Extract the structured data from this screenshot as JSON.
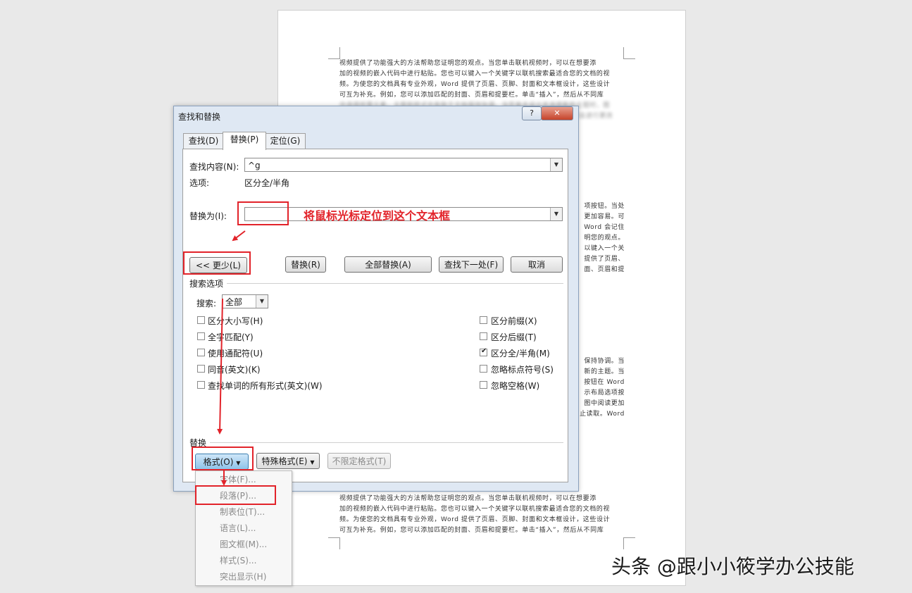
{
  "document": {
    "top_lines": [
      "视频提供了功能强大的方法帮助您证明您的观点。当您单击联机视频时，可以在想要添",
      "加的视频的嵌入代码中进行粘贴。您也可以键入一个关键字以联机搜索最适合您的文档的视",
      "频。为使您的文档具有专业外观，Word 提供了页眉、页脚、封面和文本框设计，这些设计",
      "可互为补充。例如，您可以添加匹配的封面、页眉和提要栏。单击“插入”，然后从不同库",
      "中选择所需元素。主题和样式也有助于文档保持协调。当您单击设计并选择新的主题时，图",
      "片、图表或 SmartArt 图形将会更改以匹配新的主题。当应用样式时，您的标题会进行更改"
    ],
    "right_block_1": [
      "项按钮。当处",
      "更加容易。可",
      "Word 会记住",
      "明您的观点。",
      "以键入一个关",
      "提供了页眉、",
      "面、页眉和提"
    ],
    "right_block_2": [
      "保持协调。当",
      "新的主题。当",
      "按钮在 Word",
      "示布局选项按",
      "图中阅读更加",
      "止读取。Word"
    ],
    "bottom_lines": [
      "视频提供了功能强大的方法帮助您证明您的观点。当您单击联机视频时，可以在想要添",
      "加的视频的嵌入代码中进行粘贴。您也可以键入一个关键字以联机搜索最适合您的文档的视",
      "频。为使您的文档具有专业外观，Word 提供了页眉、页脚、封面和文本框设计，这些设计",
      "可互为补充。例如，您可以添加匹配的封面、页眉和提要栏。单击“插入”，然后从不同库"
    ]
  },
  "dialog": {
    "title": "查找和替换",
    "help_label": "?",
    "close_label": "✕",
    "tabs": [
      {
        "label": "查找(D)",
        "active": false
      },
      {
        "label": "替换(P)",
        "active": true
      },
      {
        "label": "定位(G)",
        "active": false
      }
    ],
    "find_label": "查找内容(N):",
    "find_value": "^g",
    "options_label": "选项:",
    "options_value": "区分全/半角",
    "replace_label": "替换为(I):",
    "replace_value": "",
    "buttons": {
      "less": "<< 更少(L)",
      "replace": "替换(R)",
      "replace_all": "全部替换(A)",
      "find_next": "查找下一处(F)",
      "cancel": "取消"
    },
    "search_options_heading": "搜索选项",
    "search_label": "搜索:",
    "search_value": "全部",
    "left_checks": [
      {
        "label": "区分大小写(H)",
        "checked": false
      },
      {
        "label": "全字匹配(Y)",
        "checked": false
      },
      {
        "label": "使用通配符(U)",
        "checked": false
      },
      {
        "label": "同音(英文)(K)",
        "checked": false
      },
      {
        "label": "查找单词的所有形式(英文)(W)",
        "checked": false
      }
    ],
    "right_checks": [
      {
        "label": "区分前缀(X)",
        "checked": false
      },
      {
        "label": "区分后缀(T)",
        "checked": false
      },
      {
        "label": "区分全/半角(M)",
        "checked": true
      },
      {
        "label": "忽略标点符号(S)",
        "checked": false
      },
      {
        "label": "忽略空格(W)",
        "checked": false
      }
    ],
    "replace_heading": "替换",
    "format_button": "格式(O)",
    "special_button": "特殊格式(E)",
    "no_format_button": "不限定格式(T)"
  },
  "format_menu": {
    "items": [
      "字体(F)...",
      "段落(P)...",
      "制表位(T)...",
      "语言(L)...",
      "图文框(M)...",
      "样式(S)...",
      "突出显示(H)"
    ]
  },
  "annotation": {
    "text": "将鼠标光标定位到这个文本框",
    "color": "#e2232a"
  },
  "watermark": "头条 @跟小小筱学办公技能"
}
